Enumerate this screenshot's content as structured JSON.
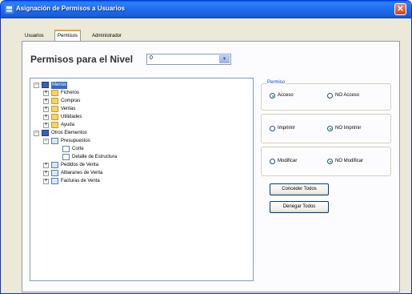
{
  "window": {
    "title": "Asignación de Permisos a Usuarios"
  },
  "tabs": [
    {
      "label": "Usuarios"
    },
    {
      "label": "Permisos"
    },
    {
      "label": "Administrador"
    }
  ],
  "heading": {
    "text": "Permisos para el Nivel"
  },
  "level_select": {
    "value": "0"
  },
  "tree": [
    {
      "label": "Menús",
      "selected": true
    },
    {
      "label": "Ficheros"
    },
    {
      "label": "Compras"
    },
    {
      "label": "Ventas"
    },
    {
      "label": "Utilidades"
    },
    {
      "label": "Ayuda"
    },
    {
      "label": "Otros Elementos"
    },
    {
      "label": "Presupuestos"
    },
    {
      "label": "Corte"
    },
    {
      "label": "Detalle de Estructura"
    },
    {
      "label": "Pedidos de Venta"
    },
    {
      "label": "Albaranes de Venta"
    },
    {
      "label": "Facturas de Venta"
    }
  ],
  "permisos": {
    "legend": "Permiso",
    "access": {
      "yes": "Acceso",
      "no": "NO Acceso",
      "selected": "yes"
    },
    "print": {
      "yes": "Imprimir",
      "no": "NO Imprimir",
      "selected": "no"
    },
    "modify": {
      "yes": "Modificar",
      "no": "NO Modificar",
      "selected": "no"
    }
  },
  "buttons": {
    "grant_all": "Conceder Todos",
    "deny_all": "Denegar Todos"
  },
  "colors": {
    "title_bar": "#1f6ff0",
    "selection": "#316ac5"
  }
}
